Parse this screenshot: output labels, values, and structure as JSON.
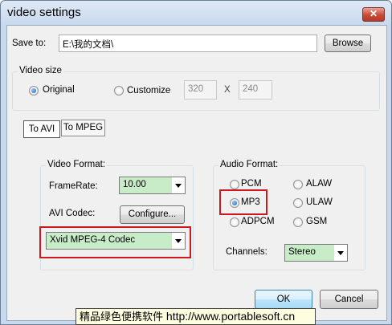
{
  "window": {
    "title": "video settings",
    "close_label": "✕"
  },
  "save_to": {
    "label": "Save to:",
    "path": "E:\\我的文档\\",
    "browse_label": "Browse"
  },
  "video_size": {
    "group_title": "Video size",
    "original_label": "Original",
    "customize_label": "Customize",
    "width": "320",
    "separator": "X",
    "height": "240",
    "selected": "Original"
  },
  "tabs": [
    {
      "label": "To AVI",
      "active": true
    },
    {
      "label": "To MPEG",
      "active": false
    }
  ],
  "video_format": {
    "group_title": "Video Format:",
    "framerate_label": "FrameRate:",
    "framerate_value": "10.00",
    "codec_label": "AVI Codec:",
    "configure_label": "Configure...",
    "codec_value": "Xvid MPEG-4 Codec"
  },
  "audio_format": {
    "group_title": "Audio Format:",
    "options": [
      "PCM",
      "ALAW",
      "MP3",
      "ULAW",
      "ADPCM",
      "GSM"
    ],
    "selected": "MP3",
    "channels_label": "Channels:",
    "channels_value": "Stereo"
  },
  "buttons": {
    "ok_label": "OK",
    "cancel_label": "Cancel"
  },
  "watermark": {
    "cn_text": "精品绿色便携软件",
    "url": "http://www.portablesoft.cn"
  },
  "colors": {
    "highlight_border": "#d0161e",
    "combo_fill": "#c8ecc8",
    "watermark_bg": "#fffde0"
  }
}
